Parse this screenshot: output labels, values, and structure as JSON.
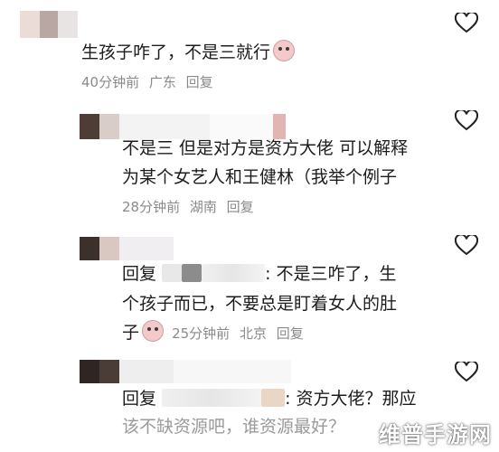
{
  "comments": [
    {
      "text": "生孩子咋了，不是三就行",
      "time": "40分钟前",
      "location": "广东",
      "reply": "回复"
    },
    {
      "line1": "不是三 但是对方是资方大佬 可以解释",
      "line2": "为某个女艺人和王健林（我举个例子",
      "time": "28分钟前",
      "location": "湖南",
      "reply": "回复"
    },
    {
      "prefix": "回复",
      "line1_tail": ": 不是三咋了，生",
      "line2": "个孩子而已，不要总是盯着女人的肚",
      "line3": "子",
      "time": "25分钟前",
      "location": "北京",
      "reply": "回复"
    },
    {
      "prefix": "回复",
      "line1_tail": ": 资方大佬？那应",
      "line2": "该不缺资源吧，谁资源最好？"
    }
  ],
  "watermark": "维普手游网",
  "icons": [
    "heart-icon",
    "laugh-emoji-icon"
  ],
  "colors": {
    "text": "#1c1c1c",
    "meta": "#8a8a8a",
    "background": "#ffffff"
  }
}
